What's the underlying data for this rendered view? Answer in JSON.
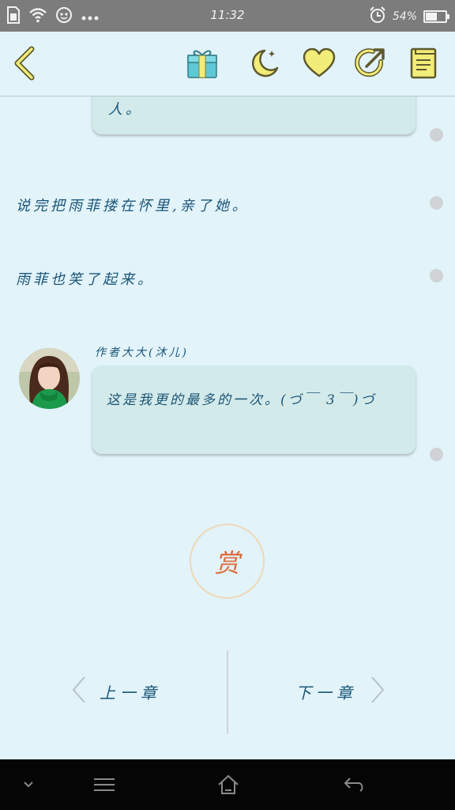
{
  "status_bar": {
    "time": "11:32",
    "battery_percent": "54%",
    "battery_level": 0.54,
    "icons": [
      "sim-card-icon",
      "wifi-icon",
      "app-notification-icon",
      "more-dots-icon",
      "alarm-icon",
      "battery-icon"
    ]
  },
  "toolbar": {
    "icons": [
      "back-arrow-icon",
      "gift-icon",
      "moon-icon",
      "heart-icon",
      "share-icon",
      "book-icon"
    ],
    "accent_color": "#f2ec78",
    "stroke_color": "#5e5a2e"
  },
  "story": {
    "bubble_top_text": "人。",
    "narration_1": "说完把雨菲搂在怀里,亲了她。",
    "narration_2": "雨菲也笑了起来。",
    "author_name": "作者大大(沐儿)",
    "author_message": "这是我更的最多的一次。(づ￣ 3￣)づ"
  },
  "reward": {
    "label": "赏"
  },
  "chapter_nav": {
    "prev_label": "上一章",
    "next_label": "下一章"
  },
  "nav_bar": {
    "icons": [
      "chevron-down-icon",
      "menu-icon",
      "home-icon",
      "back-icon"
    ]
  }
}
